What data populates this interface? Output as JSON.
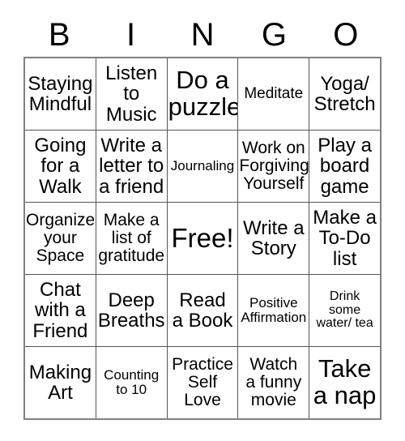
{
  "card": {
    "title_letters": [
      "B",
      "I",
      "N",
      "G",
      "O"
    ],
    "colors": {
      "background": "#ffffff",
      "text": "#000000",
      "outer_border": "#808080",
      "inner_border": "#555555"
    },
    "grid": {
      "columns": 5,
      "rows": 5,
      "free_space": {
        "row": 3,
        "column": 3,
        "label": "Free!"
      },
      "cells": [
        [
          {
            "text": "Staying\nMindful",
            "size": "md"
          },
          {
            "text": "Listen\nto\nMusic",
            "size": "md"
          },
          {
            "text": "Do a\npuzzle",
            "size": "lg"
          },
          {
            "text": "Meditate",
            "size": "xs"
          },
          {
            "text": "Yoga/\nStretch",
            "size": "md"
          }
        ],
        [
          {
            "text": "Going\nfor a\nWalk",
            "size": "md"
          },
          {
            "text": "Write a\nletter to\na friend",
            "size": "md"
          },
          {
            "text": "Journaling",
            "size": "xxs"
          },
          {
            "text": "Work on\nForgiving\nYourself",
            "size": "sm"
          },
          {
            "text": "Play a\nboard\ngame",
            "size": "md"
          }
        ],
        [
          {
            "text": "Organize\nyour\nSpace",
            "size": "sm"
          },
          {
            "text": "Make a\nlist of\ngratitude",
            "size": "sm"
          },
          {
            "text": "Free!",
            "size": "xl"
          },
          {
            "text": "Write a\nStory",
            "size": "md"
          },
          {
            "text": "Make a\nTo-Do\nlist",
            "size": "md"
          }
        ],
        [
          {
            "text": "Chat\nwith a\nFriend",
            "size": "md"
          },
          {
            "text": "Deep\nBreaths",
            "size": "md"
          },
          {
            "text": "Read\na Book",
            "size": "md"
          },
          {
            "text": "Positive\nAffirmation",
            "size": "xxs"
          },
          {
            "text": "Drink\nsome\nwater/ tea",
            "size": "tiny"
          }
        ],
        [
          {
            "text": "Making\nArt",
            "size": "md"
          },
          {
            "text": "Counting\nto 10",
            "size": "xxs"
          },
          {
            "text": "Practice\nSelf\nLove",
            "size": "sm"
          },
          {
            "text": "Watch\na funny\nmovie",
            "size": "sm"
          },
          {
            "text": "Take\na nap",
            "size": "lg"
          }
        ]
      ]
    }
  }
}
